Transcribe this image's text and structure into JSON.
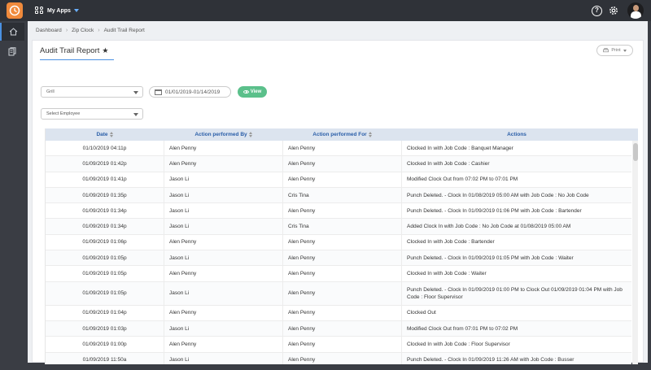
{
  "topbar": {
    "apps_label": "My Apps"
  },
  "breadcrumb": [
    "Dashboard",
    "Zip Clock",
    "Audit Trail Report"
  ],
  "page": {
    "title": "Audit Trail Report",
    "print_label": "Print"
  },
  "filters": {
    "location": "Grill",
    "date_range": "01/01/2019-01/14/2019",
    "view_label": "View",
    "employee_placeholder": "Select Employee"
  },
  "table": {
    "columns": [
      "Date",
      "Action performed By",
      "Action performed For",
      "Actions"
    ],
    "rows": [
      {
        "date": "01/10/2019 04:11p",
        "by": "Alen Penny",
        "for": "Alen Penny",
        "action": "Clocked In with Job Code : Banquet Manager"
      },
      {
        "date": "01/09/2019 01:42p",
        "by": "Alen Penny",
        "for": "Alen Penny",
        "action": "Clocked In with Job Code : Cashier"
      },
      {
        "date": "01/09/2019 01:41p",
        "by": "Jason Li",
        "for": "Alen Penny",
        "action": "Modified Clock Out from 07:02 PM to 07:01 PM"
      },
      {
        "date": "01/09/2019 01:35p",
        "by": "Jason Li",
        "for": "Cris Tina",
        "action": "Punch Deleted. - Clock In 01/08/2019 05:00 AM with Job Code : No Job Code"
      },
      {
        "date": "01/09/2019 01:34p",
        "by": "Jason Li",
        "for": "Alen Penny",
        "action": "Punch Deleted. - Clock In 01/09/2019 01:06 PM with Job Code : Bartender"
      },
      {
        "date": "01/09/2019 01:34p",
        "by": "Jason Li",
        "for": "Cris Tina",
        "action": "Added Clock In with Job Code : No Job Code at 01/08/2019 05:00 AM"
      },
      {
        "date": "01/09/2019 01:06p",
        "by": "Alen Penny",
        "for": "Alen Penny",
        "action": "Clocked In with Job Code : Bartender"
      },
      {
        "date": "01/09/2019 01:05p",
        "by": "Jason Li",
        "for": "Alen Penny",
        "action": "Punch Deleted. - Clock In 01/09/2019 01:05 PM with Job Code : Waiter"
      },
      {
        "date": "01/09/2019 01:05p",
        "by": "Alen Penny",
        "for": "Alen Penny",
        "action": "Clocked In with Job Code : Waiter"
      },
      {
        "date": "01/09/2019 01:05p",
        "by": "Jason Li",
        "for": "Alen Penny",
        "action": "Punch Deleted. - Clock In 01/09/2019 01:00 PM to Clock Out 01/09/2019 01:04 PM with Job Code : Floor Supervisor"
      },
      {
        "date": "01/09/2019 01:04p",
        "by": "Alen Penny",
        "for": "Alen Penny",
        "action": "Clocked Out"
      },
      {
        "date": "01/09/2019 01:03p",
        "by": "Jason Li",
        "for": "Alen Penny",
        "action": "Modified Clock Out from 07:01 PM to 07:02 PM"
      },
      {
        "date": "01/09/2019 01:00p",
        "by": "Alen Penny",
        "for": "Alen Penny",
        "action": "Clocked In with Job Code : Floor Supervisor"
      },
      {
        "date": "01/09/2019 11:50a",
        "by": "Jason Li",
        "for": "Alen Penny",
        "action": "Punch Deleted. - Clock In 01/09/2019 11:26 AM with Job Code : Busser"
      }
    ]
  },
  "colors": {
    "topbar": "#2f3238",
    "logo": "#f08a3c",
    "accent": "#4a90e2",
    "header_text": "#2a5ea8",
    "view_button": "#5bc08b"
  }
}
